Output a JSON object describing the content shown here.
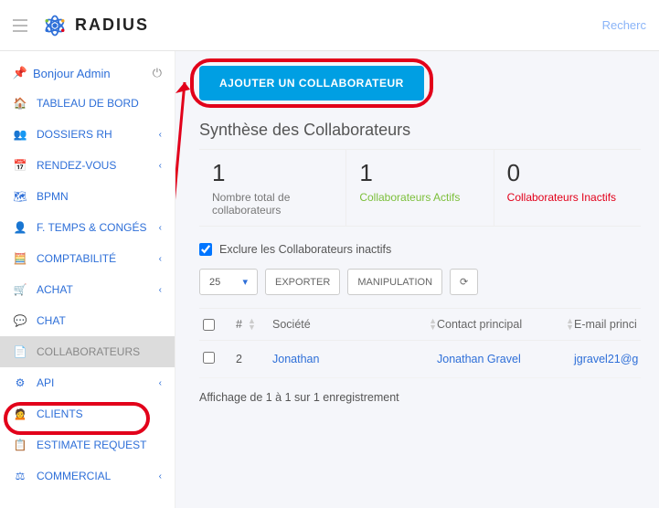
{
  "brand": "RADIUS",
  "search_placeholder": "Recherc",
  "greeting_prefix": "Bonjour",
  "greeting_user": "Admin",
  "sidebar": {
    "items": [
      {
        "label": "TABLEAU DE BORD",
        "icon": "home"
      },
      {
        "label": "DOSSIERS RH",
        "icon": "users",
        "chev": true
      },
      {
        "label": "RENDEZ-VOUS",
        "icon": "calendar",
        "chev": true
      },
      {
        "label": "BPMN",
        "icon": "map"
      },
      {
        "label": "F. TEMPS & CONGÉS",
        "icon": "user-circle",
        "chev": true
      },
      {
        "label": "COMPTABILITÉ",
        "icon": "calc",
        "chev": true
      },
      {
        "label": "ACHAT",
        "icon": "cart",
        "chev": true
      },
      {
        "label": "CHAT",
        "icon": "chat"
      },
      {
        "label": "COLLABORATEURS",
        "icon": "doc",
        "active": true
      },
      {
        "label": "API",
        "icon": "gear",
        "chev": true
      },
      {
        "label": "CLIENTS",
        "icon": "client"
      },
      {
        "label": "ESTIMATE REQUEST",
        "icon": "list"
      },
      {
        "label": "COMMERCIAL",
        "icon": "scale",
        "chev": true
      }
    ]
  },
  "add_button": "AJOUTER UN COLLABORATEUR",
  "summary_title": "Synthèse des Collaborateurs",
  "stats": [
    {
      "num": "1",
      "lbl": "Nombre total de collaborateurs",
      "cls": ""
    },
    {
      "num": "1",
      "lbl": "Collaborateurs Actifs",
      "cls": "green"
    },
    {
      "num": "0",
      "lbl": "Collaborateurs Inactifs",
      "cls": "red"
    }
  ],
  "exclude_label": "Exclure les Collaborateurs inactifs",
  "page_size": "25",
  "export_label": "EXPORTER",
  "manip_label": "MANIPULATION",
  "columns": {
    "idx": "#",
    "societe": "Société",
    "contact": "Contact principal",
    "email": "E-mail princi"
  },
  "rows": [
    {
      "idx": "2",
      "societe": "Jonathan",
      "contact": "Jonathan Gravel",
      "email": "jgravel21@g"
    }
  ],
  "footer": "Affichage de 1 à 1 sur 1 enregistrement"
}
